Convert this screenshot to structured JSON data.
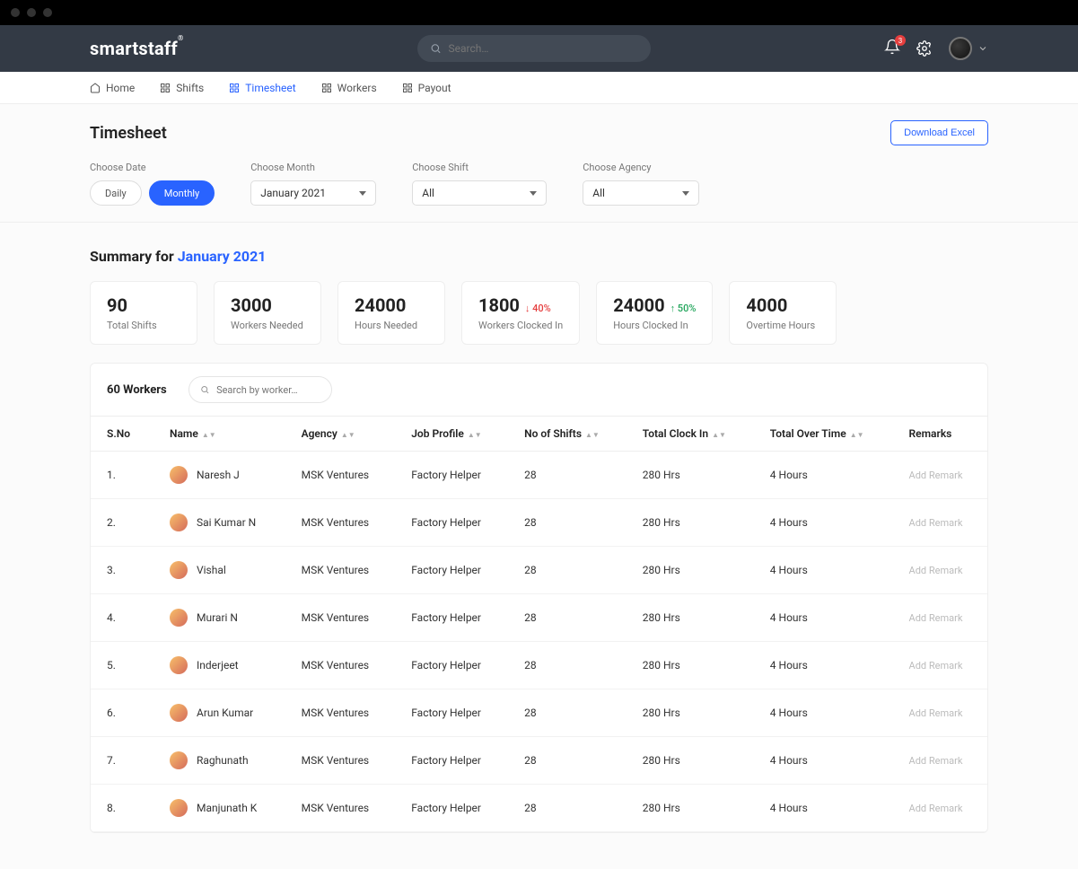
{
  "brand": "smartstaff",
  "search": {
    "placeholder": "Search…"
  },
  "notif_badge": "3",
  "nav": {
    "home": "Home",
    "shifts": "Shifts",
    "timesheet": "Timesheet",
    "workers": "Workers",
    "payout": "Payout"
  },
  "page_title": "Timesheet",
  "download_btn": "Download Excel",
  "filters": {
    "choose_date_label": "Choose Date",
    "daily": "Daily",
    "monthly": "Monthly",
    "choose_month_label": "Choose Month",
    "month_value": "January 2021",
    "choose_shift_label": "Choose Shift",
    "shift_value": "All",
    "choose_agency_label": "Choose Agency",
    "agency_value": "All"
  },
  "summary": {
    "title_prefix": "Summary for ",
    "title_month": "January 2021",
    "cards": [
      {
        "value": "90",
        "label": "Total Shifts"
      },
      {
        "value": "3000",
        "label": "Workers Needed"
      },
      {
        "value": "24000",
        "label": "Hours Needed"
      },
      {
        "value": "1800",
        "label": "Workers Clocked In",
        "pct": "40%",
        "dir": "down"
      },
      {
        "value": "24000",
        "label": "Hours Clocked In",
        "pct": "50%",
        "dir": "up"
      },
      {
        "value": "4000",
        "label": "Overtime Hours"
      }
    ]
  },
  "table": {
    "workers_count": "60 Workers",
    "search_placeholder": "Search by worker…",
    "columns": {
      "sno": "S.No",
      "name": "Name",
      "agency": "Agency",
      "job": "Job Profile",
      "shifts": "No of Shifts",
      "clockin": "Total Clock In",
      "overtime": "Total Over Time",
      "remarks": "Remarks"
    },
    "remark_action": "Add Remark",
    "rows": [
      {
        "sno": "1.",
        "name": "Naresh J",
        "agency": "MSK Ventures",
        "job": "Factory Helper",
        "shifts": "28",
        "clockin": "280 Hrs",
        "overtime": "4 Hours"
      },
      {
        "sno": "2.",
        "name": "Sai Kumar N",
        "agency": "MSK Ventures",
        "job": "Factory Helper",
        "shifts": "28",
        "clockin": "280 Hrs",
        "overtime": "4 Hours"
      },
      {
        "sno": "3.",
        "name": "Vishal",
        "agency": "MSK Ventures",
        "job": "Factory Helper",
        "shifts": "28",
        "clockin": "280 Hrs",
        "overtime": "4 Hours"
      },
      {
        "sno": "4.",
        "name": "Murari N",
        "agency": "MSK Ventures",
        "job": "Factory Helper",
        "shifts": "28",
        "clockin": "280 Hrs",
        "overtime": "4 Hours"
      },
      {
        "sno": "5.",
        "name": "Inderjeet",
        "agency": "MSK Ventures",
        "job": "Factory Helper",
        "shifts": "28",
        "clockin": "280 Hrs",
        "overtime": "4 Hours"
      },
      {
        "sno": "6.",
        "name": "Arun Kumar",
        "agency": "MSK Ventures",
        "job": "Factory Helper",
        "shifts": "28",
        "clockin": "280 Hrs",
        "overtime": "4 Hours"
      },
      {
        "sno": "7.",
        "name": "Raghunath",
        "agency": "MSK Ventures",
        "job": "Factory Helper",
        "shifts": "28",
        "clockin": "280 Hrs",
        "overtime": "4 Hours"
      },
      {
        "sno": "8.",
        "name": "Manjunath K",
        "agency": "MSK Ventures",
        "job": "Factory Helper",
        "shifts": "28",
        "clockin": "280 Hrs",
        "overtime": "4 Hours"
      }
    ]
  }
}
